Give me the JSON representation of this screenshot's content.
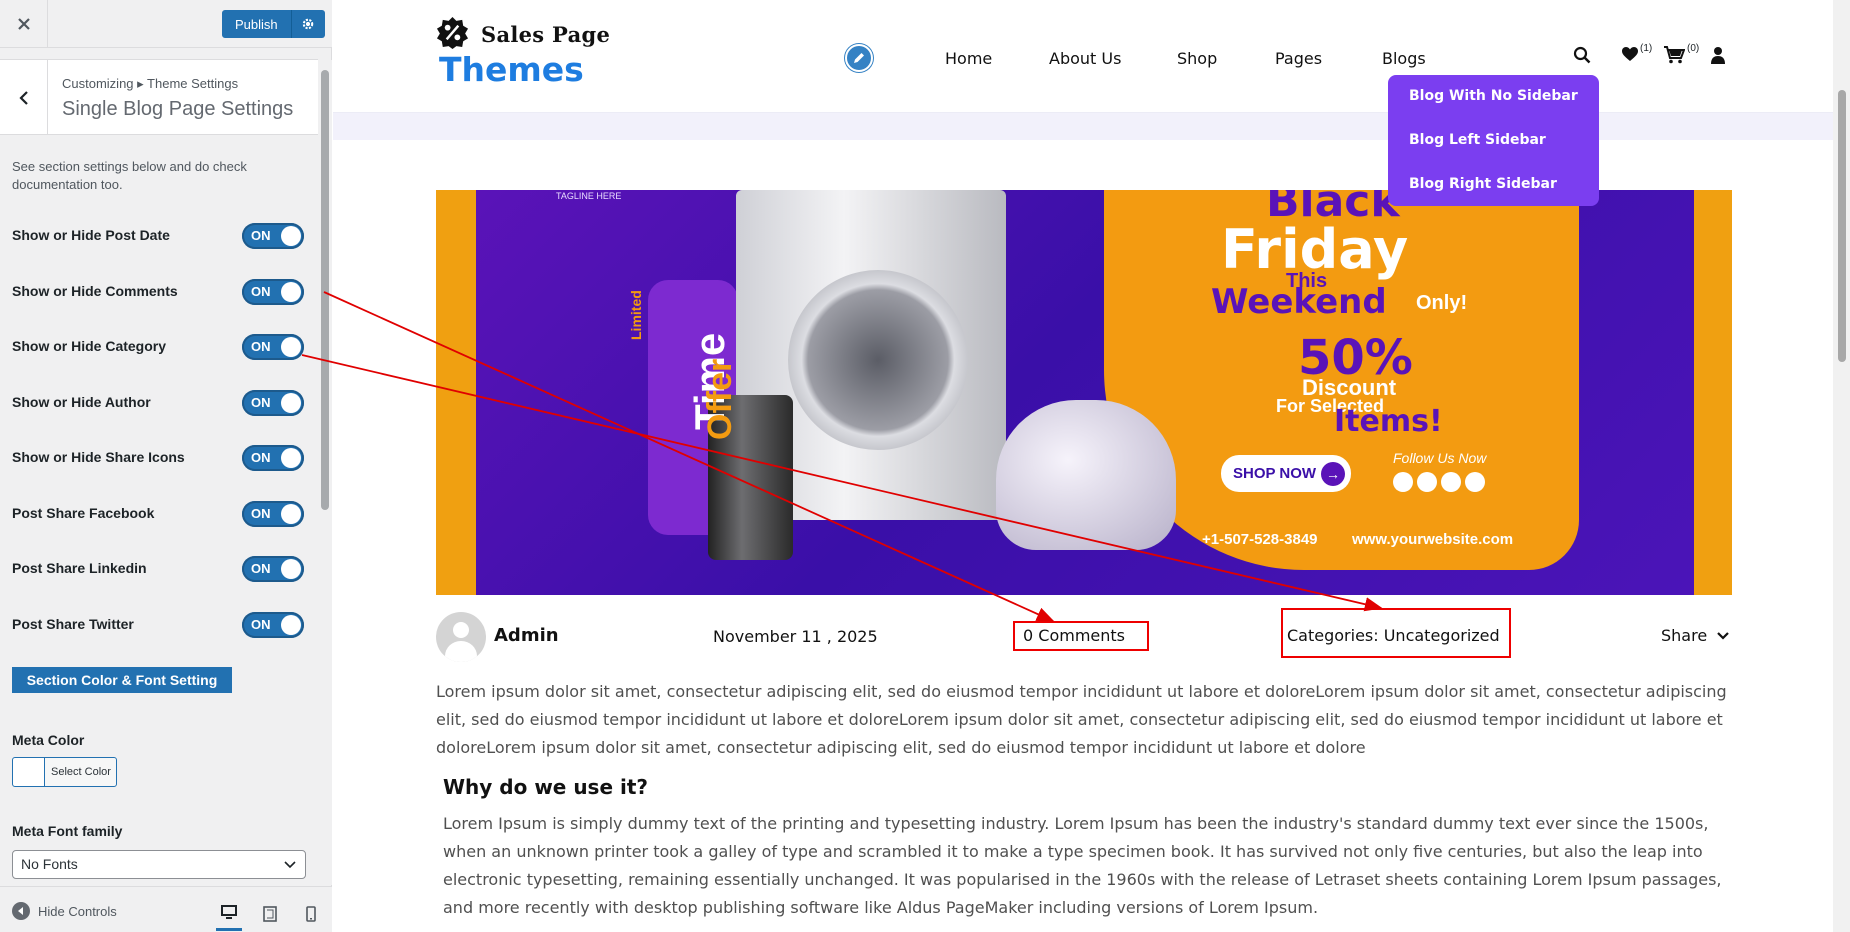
{
  "panel": {
    "close_icon": "close-icon",
    "publish_label": "Publish",
    "breadcrumb": "Customizing ▸ Theme Settings",
    "section_title": "Single Blog Page Settings",
    "description": "See section settings below and do check documentation too.",
    "toggles": [
      {
        "label": "Show or Hide Post Date",
        "state": "ON"
      },
      {
        "label": "Show or Hide Comments",
        "state": "ON"
      },
      {
        "label": "Show or Hide Category",
        "state": "ON"
      },
      {
        "label": "Show or Hide Author",
        "state": "ON"
      },
      {
        "label": "Show or Hide Share Icons",
        "state": "ON"
      },
      {
        "label": "Post Share Facebook",
        "state": "ON"
      },
      {
        "label": "Post Share Linkedin",
        "state": "ON"
      },
      {
        "label": "Post Share Twitter",
        "state": "ON"
      }
    ],
    "color_font_button": "Section Color & Font Setting",
    "meta_color_label": "Meta Color",
    "select_color": "Select Color",
    "meta_font_label": "Meta Font family",
    "meta_font_value": "No Fonts",
    "hide_controls": "Hide Controls",
    "accent_color": "#2271b1"
  },
  "site": {
    "logo_line1": "Sales Page",
    "logo_line2": "Themes",
    "nav": [
      "Home",
      "About Us",
      "Shop",
      "Pages",
      "Blogs"
    ],
    "wishlist_count": "(1)",
    "cart_count": "(0)",
    "blog_dropdown": [
      "Blog With No Sidebar",
      "Blog Left Sidebar",
      "Blog Right Sidebar"
    ],
    "dropdown_color": "#7b3ef0",
    "brand_color": "#1e7de0"
  },
  "banner": {
    "tagline": "TAGLINE HERE",
    "limited": "Limited",
    "time": "Time",
    "offer": "Offer",
    "black": "Black",
    "friday": "Friday",
    "this": "This",
    "weekend": "Weekend",
    "only": "Only!",
    "percent": "50%",
    "discount": "Discount",
    "for_selected": "For Selected",
    "items": "Items!",
    "shop_now": "SHOP NOW",
    "follow": "Follow Us Now",
    "phone": "+1-507-528-3849",
    "website": "www.yourwebsite.com"
  },
  "post": {
    "author": "Admin",
    "date": "November 11 , 2025",
    "comments": "0 Comments",
    "categories": "Categories: Uncategorized",
    "share": "Share",
    "paragraph1": "Lorem ipsum dolor sit amet, consectetur adipiscing elit, sed do eiusmod tempor incididunt ut labore et doloreLorem ipsum dolor sit amet, consectetur adipiscing elit, sed do eiusmod tempor incididunt ut labore et doloreLorem ipsum dolor sit amet, consectetur adipiscing elit, sed do eiusmod tempor incididunt ut labore et doloreLorem ipsum dolor sit amet, consectetur adipiscing elit, sed do eiusmod tempor incididunt ut labore et dolore",
    "heading": "Why do we use it?",
    "paragraph2": "Lorem Ipsum is simply dummy text of the printing and typesetting industry. Lorem Ipsum has been the industry's standard dummy text ever since the 1500s, when an unknown printer took a galley of type and scrambled it to make a type specimen book. It has survived not only five centuries, but also the leap into electronic typesetting, remaining essentially unchanged. It was popularised in the 1960s with the release of Letraset sheets containing Lorem Ipsum passages, and more recently with desktop publishing software like Aldus PageMaker including versions of Lorem Ipsum."
  },
  "annotation_color": "#e00000"
}
